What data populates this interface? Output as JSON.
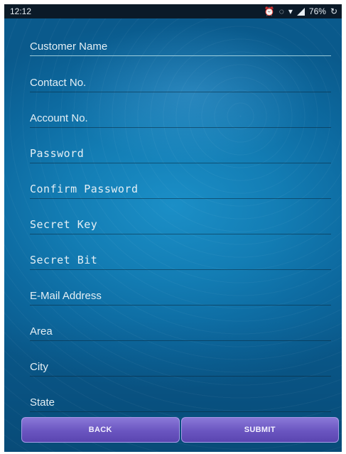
{
  "status_bar": {
    "time": "12:12",
    "battery": "76%"
  },
  "form": {
    "fields": [
      {
        "placeholder": "Customer Name",
        "value": "",
        "mono": false
      },
      {
        "placeholder": "Contact No.",
        "value": "",
        "mono": false
      },
      {
        "placeholder": "Account No.",
        "value": "",
        "mono": false
      },
      {
        "placeholder": "Password",
        "value": "",
        "mono": true
      },
      {
        "placeholder": "Confirm Password",
        "value": "",
        "mono": true
      },
      {
        "placeholder": "Secret Key",
        "value": "",
        "mono": true
      },
      {
        "placeholder": "Secret Bit",
        "value": "",
        "mono": true
      },
      {
        "placeholder": "E-Mail Address",
        "value": "",
        "mono": false
      },
      {
        "placeholder": "Area",
        "value": "",
        "mono": false
      },
      {
        "placeholder": "City",
        "value": "",
        "mono": false
      },
      {
        "placeholder": "State",
        "value": "",
        "mono": false
      }
    ]
  },
  "buttons": {
    "back_label": "BACK",
    "submit_label": "SUBMIT"
  },
  "colors": {
    "background": "#137db4",
    "button": "#6a55c0",
    "status_bar": "#0b1a28"
  }
}
